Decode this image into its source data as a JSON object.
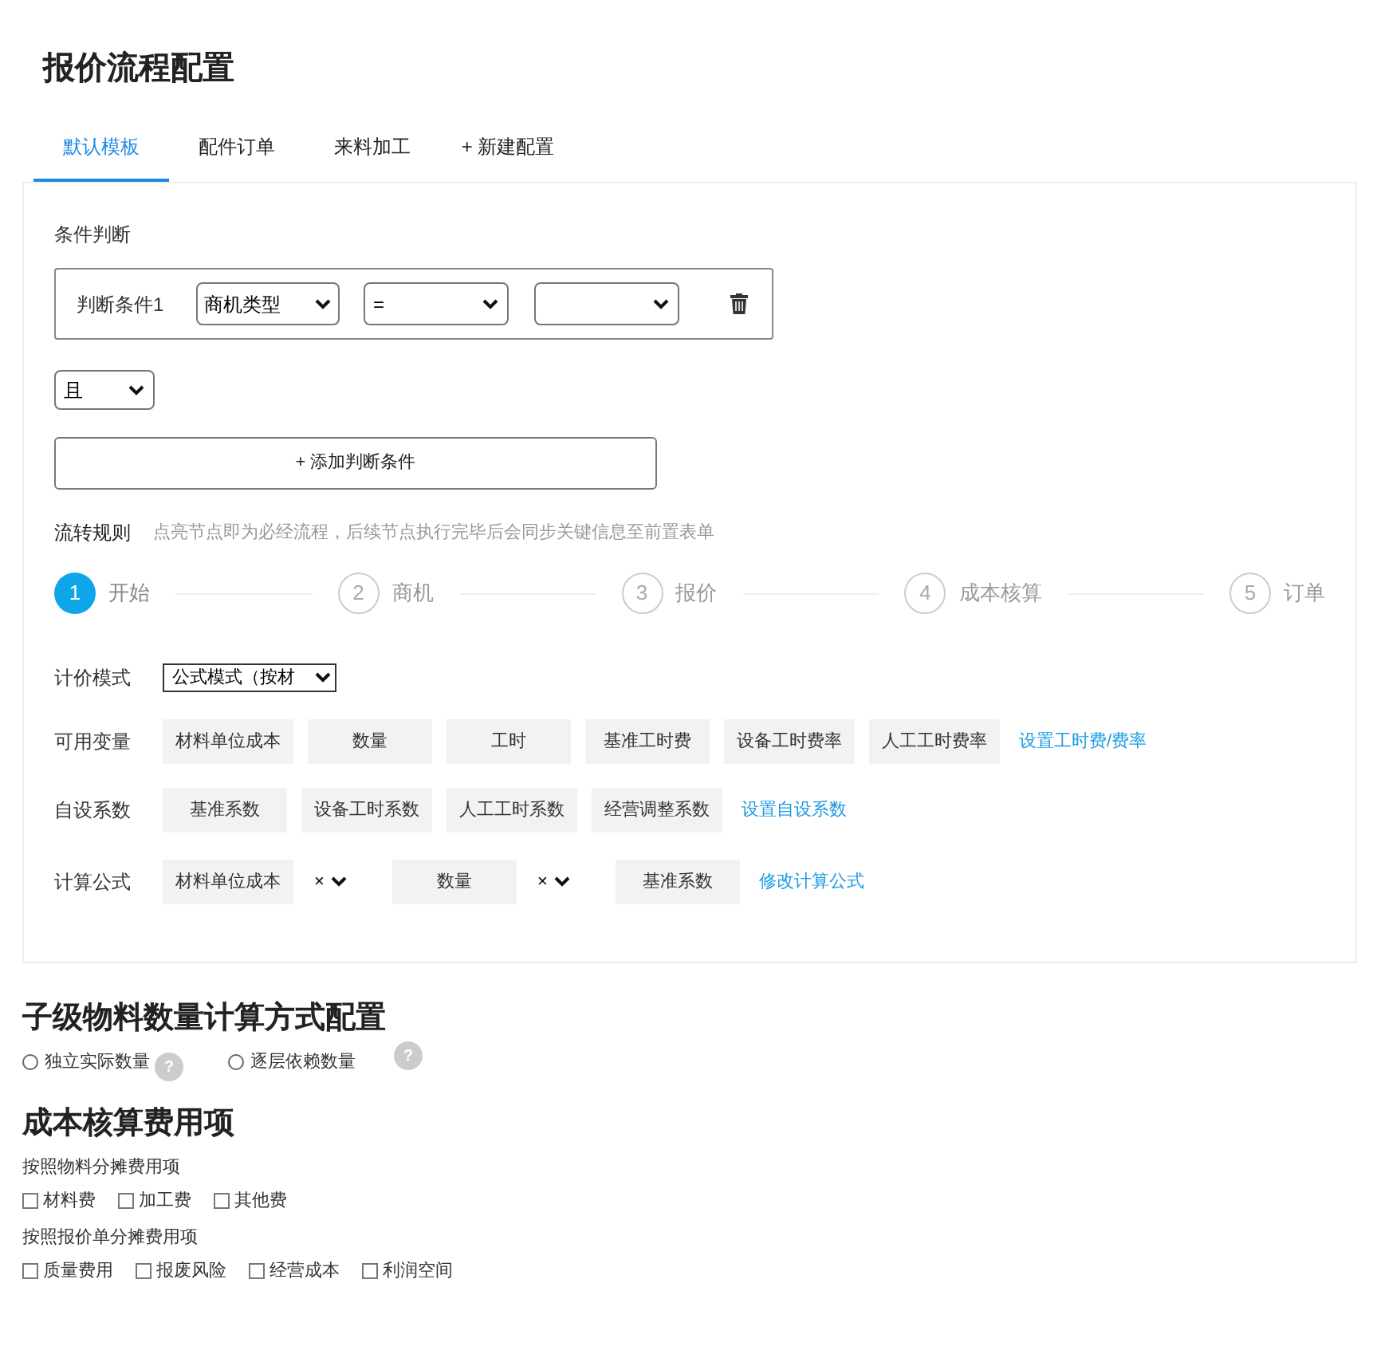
{
  "title": "报价流程配置",
  "tabs": [
    {
      "label": "默认模板",
      "selected": true
    },
    {
      "label": "配件订单",
      "selected": false
    },
    {
      "label": "来料加工",
      "selected": false
    },
    {
      "label": "+ 新建配置",
      "selected": false
    }
  ],
  "conditions": {
    "label": "条件判断",
    "rows": [
      {
        "label": "判断条件1",
        "field": "商机类型",
        "operator": "=",
        "value": ""
      }
    ],
    "connector": "且",
    "add_button": "+ 添加判断条件"
  },
  "flow": {
    "label": "流转规则",
    "hint": "点亮节点即为必经流程，后续节点执行完毕后会同步关键信息至前置表单",
    "steps": [
      {
        "number": "1",
        "label": "开始",
        "active": true
      },
      {
        "number": "2",
        "label": "商机",
        "active": false
      },
      {
        "number": "3",
        "label": "报价",
        "active": false
      },
      {
        "number": "4",
        "label": "成本核算",
        "active": false
      },
      {
        "number": "5",
        "label": "订单",
        "active": false
      }
    ]
  },
  "pricing": {
    "mode_label": "计价模式",
    "mode_value": "公式模式（按材",
    "variables": {
      "label": "可用变量",
      "items": [
        "材料单位成本",
        "数量",
        "工时",
        "基准工时费",
        "设备工时费率",
        "人工工时费率"
      ],
      "link": "设置工时费/费率"
    },
    "coefficients": {
      "label": "自设系数",
      "items": [
        "基准系数",
        "设备工时系数",
        "人工工时系数",
        "经营调整系数"
      ],
      "link": "设置自设系数"
    },
    "formula": {
      "label": "计算公式",
      "terms": [
        {
          "kind": "term",
          "text": "材料单位成本"
        },
        {
          "kind": "operator",
          "text": "×"
        },
        {
          "kind": "term",
          "text": "数量"
        },
        {
          "kind": "operator",
          "text": "×"
        },
        {
          "kind": "term",
          "text": "基准系数"
        }
      ],
      "link": "修改计算公式"
    }
  },
  "child_quantity": {
    "title": "子级物料数量计算方式配置",
    "options": [
      {
        "label": "独立实际数量",
        "selected": false,
        "help": "?"
      },
      {
        "label": "逐层依赖数量",
        "selected": false,
        "help": "?"
      }
    ]
  },
  "cost_items": {
    "title": "成本核算费用项",
    "groups": [
      {
        "label": "按照物料分摊费用项",
        "items": [
          {
            "label": "材料费",
            "checked": false
          },
          {
            "label": "加工费",
            "checked": false
          },
          {
            "label": "其他费",
            "checked": false
          }
        ]
      },
      {
        "label": "按照报价单分摊费用项",
        "items": [
          {
            "label": "质量费用",
            "checked": false
          },
          {
            "label": "报废风险",
            "checked": false
          },
          {
            "label": "经营成本",
            "checked": false
          },
          {
            "label": "利润空间",
            "checked": false
          }
        ]
      }
    ]
  }
}
